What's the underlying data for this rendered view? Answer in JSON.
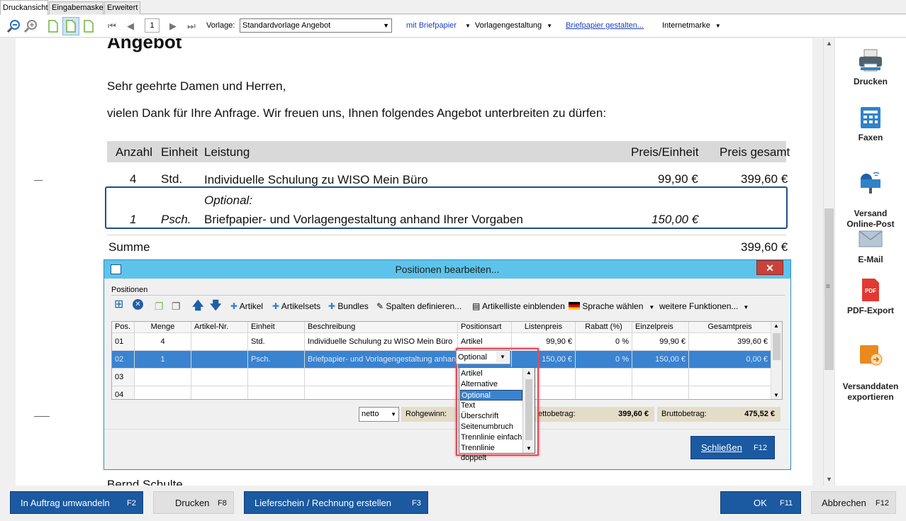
{
  "tabs": [
    "Druckansicht",
    "Eingabemaske",
    "Erweitert"
  ],
  "toolbar": {
    "page": "1",
    "vorlage_label": "Vorlage:",
    "vorlage_value": "Standardvorlage Angebot",
    "briefpapier": "mit Briefpapier",
    "vorlagengestaltung": "Vorlagengestaltung",
    "briefpapier_gestalten": "Briefpapier gestalten...",
    "internetmarke": "Internetmarke"
  },
  "doc": {
    "heading": "Angebot",
    "greeting": "Sehr geehrte Damen und Herren,",
    "intro": "vielen Dank für Ihre Anfrage. Wir freuen uns, Ihnen folgendes Angebot unterbreiten zu dürfen:",
    "headers": {
      "anzahl": "Anzahl",
      "einheit": "Einheit",
      "leistung": "Leistung",
      "preis_einheit": "Preis/Einheit",
      "preis_gesamt": "Preis gesamt"
    },
    "rows": [
      {
        "anzahl": "4",
        "einheit": "Std.",
        "leistung": "Individuelle Schulung zu WISO Mein Büro",
        "preis_einheit": "99,90 €",
        "preis_gesamt": "399,60 €"
      },
      {
        "optional_label": "Optional:",
        "anzahl": "1",
        "einheit": "Psch.",
        "leistung": "Briefpapier- und Vorlagengestaltung anhand Ihrer Vorgaben",
        "preis_einheit": "150,00 €"
      }
    ],
    "summe_label": "Summe",
    "summe_value": "399,60 €",
    "signature": "Bernd Schulte"
  },
  "right_panel": [
    "Drucken",
    "Faxen",
    "Versand\nOnline-Post",
    "E-Mail",
    "PDF-Export",
    "Versanddaten\nexportieren"
  ],
  "dialog": {
    "title": "Positionen bearbeiten...",
    "section": "Positionen",
    "tools": {
      "artikel": "Artikel",
      "artikelsets": "Artikelsets",
      "bundles": "Bundles",
      "spalten": "Spalten definieren...",
      "artikelliste": "Artikelliste einblenden",
      "sprache": "Sprache wählen",
      "weitere": "weitere Funktionen..."
    },
    "columns": [
      "Pos.",
      "Menge",
      "Artikel-Nr.",
      "Einheit",
      "Beschreibung",
      "Positionsart",
      "Listenpreis",
      "Rabatt (%)",
      "Einzelpreis",
      "Gesamtpreis"
    ],
    "rows": [
      [
        "01",
        "4",
        "",
        "Std.",
        "Individuelle Schulung zu WISO Mein Büro",
        "Artikel",
        "99,90 €",
        "0 %",
        "99,90 €",
        "399,60 €"
      ],
      [
        "02",
        "1",
        "",
        "Psch.",
        "Briefpapier- und Vorlagengestaltung anhand",
        "Optional",
        "150,00 €",
        "0 %",
        "150,00 €",
        "0,00 €"
      ],
      [
        "03",
        "",
        "",
        "",
        "",
        "",
        "",
        "",
        "",
        ""
      ],
      [
        "04",
        "",
        "",
        "",
        "",
        "",
        "",
        "",
        "",
        ""
      ]
    ],
    "netto": "netto",
    "rohgewinn_label": "Rohgewinn:",
    "netto_label": "ettobetrag:",
    "netto_value": "399,60 €",
    "brutto_label": "Bruttobetrag:",
    "brutto_value": "475,52 €",
    "schliessen": "Schließen",
    "schliessen_key": "F12",
    "dropdown_current": "Optional",
    "dropdown_options": [
      "Artikel",
      "Alternative",
      "Optional",
      "Text",
      "Überschrift",
      "Seitenumbruch",
      "Trennlinie einfach",
      "Trennlinie doppelt"
    ]
  },
  "bottom": {
    "auftrag": "In Auftrag umwandeln",
    "auftrag_key": "F2",
    "drucken": "Drucken",
    "drucken_key": "F8",
    "lieferschein": "Lieferschein / Rechnung erstellen",
    "lieferschein_key": "F3",
    "ok": "OK",
    "ok_key": "F11",
    "abbrechen": "Abbrechen",
    "abbrechen_key": "F12"
  }
}
